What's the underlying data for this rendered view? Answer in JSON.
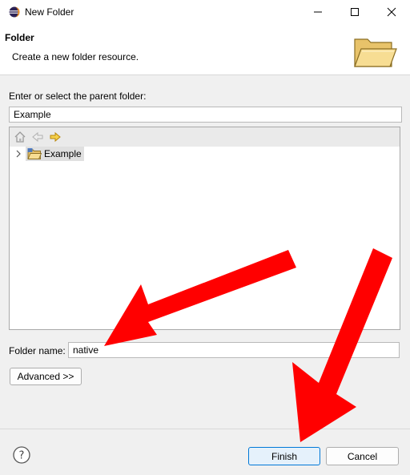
{
  "window": {
    "title": "New Folder"
  },
  "banner": {
    "title": "Folder",
    "description": "Create a new folder resource."
  },
  "parent": {
    "label": "Enter or select the parent folder:",
    "value": "Example"
  },
  "tree": {
    "items": [
      {
        "label": "Example",
        "selected": true,
        "collapsed": true
      }
    ]
  },
  "folder_name": {
    "label": "Folder name:",
    "value": "native"
  },
  "buttons": {
    "advanced": "Advanced >>",
    "finish": "Finish",
    "cancel": "Cancel"
  },
  "icons": {
    "app": "eclipse-icon",
    "banner": "open-folder-icon",
    "home": "home-icon",
    "back": "back-arrow-icon",
    "forward": "forward-arrow-icon",
    "project": "project-folder-icon",
    "help": "help-icon"
  },
  "annotations": {
    "arrow_color": "#ff0000"
  },
  "colors": {
    "accent": "#0078d7",
    "selection": "#e0e0e0"
  }
}
